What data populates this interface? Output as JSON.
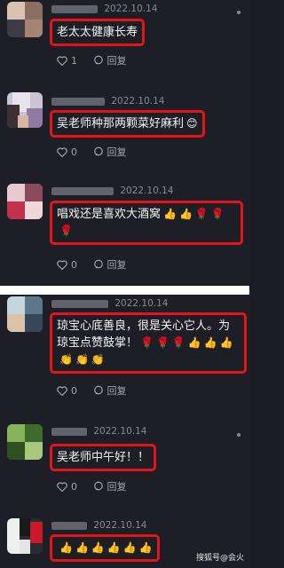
{
  "comments": [
    {
      "date": "2022.10.14",
      "text": "老太太健康长寿",
      "emojis": [],
      "likes": "1",
      "reply": "回复"
    },
    {
      "date": "2022.10.14",
      "text": "吴老师种那两颗菜好麻利",
      "emojis": [
        "😊"
      ],
      "likes": "0",
      "reply": "回复"
    },
    {
      "date": "2022.10.14",
      "text": "唱戏还是喜欢大酒窝",
      "emojis": [
        "👍",
        "👍",
        "🌹",
        "🌹",
        "🌹"
      ],
      "likes": "0",
      "reply": "回复"
    },
    {
      "date": "2022.10.14",
      "text": "琼宝心底善良，很是关心它人。为琼宝点赞鼓掌！",
      "emojis": [
        "🌹",
        "🌹",
        "🌹",
        "👍",
        "👍",
        "👍",
        "👏",
        "👏",
        "👏"
      ],
      "likes": "0",
      "reply": "回复"
    },
    {
      "date": "2022.10.14",
      "text": "吴老师中午好！！",
      "emojis": [],
      "likes": "0",
      "reply": "回复"
    },
    {
      "date": "2022.10.14",
      "text": "",
      "emojis": [
        "👍",
        "👍",
        "👍",
        "👍",
        "👍",
        "👍"
      ],
      "likes": "0",
      "reply": "回复"
    }
  ],
  "watermark": "搜狐号@会火",
  "colors": {
    "highlight": "#e3141a",
    "background": "#1e1e27"
  }
}
